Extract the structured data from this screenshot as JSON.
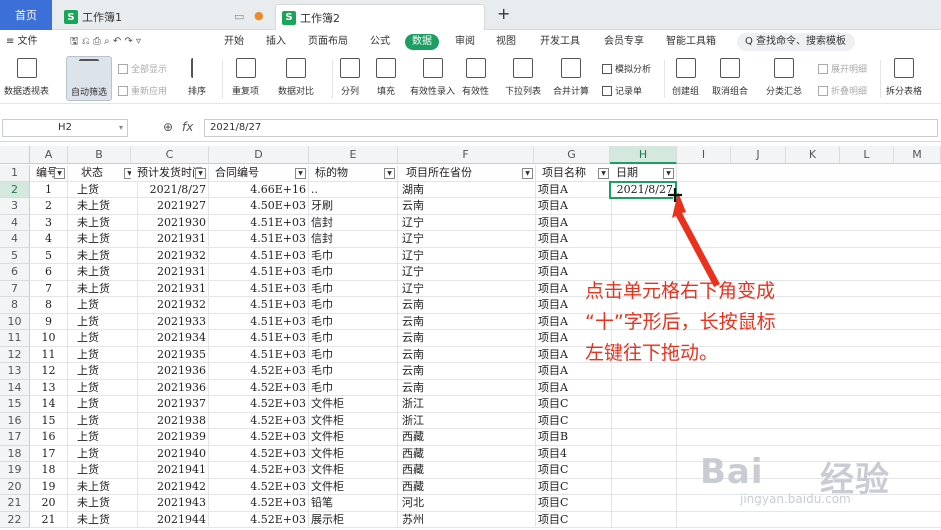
{
  "tabs": {
    "home": "首页",
    "doc1": "工作簿1",
    "doc2": "工作簿2",
    "new_tab": "+"
  },
  "menu": {
    "items": [
      "≡ 文件",
      "开始",
      "插入",
      "页面布局",
      "公式",
      "数据",
      "审阅",
      "视图",
      "开发工具",
      "会员专享",
      "智能工具箱"
    ],
    "active": "数据",
    "search": "Q 查找命令、搜索模板"
  },
  "ribbon": {
    "pivot": "数据透视表",
    "autofilter": "自动筛选",
    "show_all": "全部显示",
    "reapply": "重新应用",
    "sort": "排序",
    "dup": "重复项",
    "compare": "数据对比",
    "split": "分列",
    "fill": "填充",
    "validity": "有效性录入",
    "validity_dd": "有效性",
    "dropdown": "下拉列表",
    "merge_calc": "合并计算",
    "simulate": "模拟分析",
    "record": "记录单",
    "create_group": "创建组",
    "ungroup": "取消组合",
    "subtotal": "分类汇总",
    "expand": "展开明细",
    "collapse": "折叠明细",
    "split_table": "拆分表格"
  },
  "formula_bar": {
    "name_box": "H2",
    "fx": "fx",
    "value": "2021/8/27"
  },
  "columns": [
    "A",
    "B",
    "C",
    "D",
    "E",
    "F",
    "G",
    "H",
    "I",
    "J",
    "K",
    "L",
    "M"
  ],
  "header_row": {
    "a": "编号",
    "b": "状态",
    "c": "预计发货时间",
    "d": "合同编号",
    "e": "标的物",
    "f": "项目所在省份",
    "g": "项目名称",
    "h": "日期"
  },
  "rows": [
    {
      "n": "2",
      "a": "1",
      "b": "上货",
      "c": "2021/8/27",
      "d": "4.66E+16",
      "e": "..",
      "f": "湖南",
      "g": "项目A",
      "h": "2021/8/27"
    },
    {
      "n": "3",
      "a": "2",
      "b": "未上货",
      "c": "2021927",
      "d": "4.50E+03",
      "e": "牙刷",
      "f": "云南",
      "g": "项目A",
      "h": ""
    },
    {
      "n": "4",
      "a": "3",
      "b": "未上货",
      "c": "2021930",
      "d": "4.51E+03",
      "e": "信封",
      "f": "辽宁",
      "g": "项目A",
      "h": ""
    },
    {
      "n": "4",
      "a": "4",
      "b": "未上货",
      "c": "2021931",
      "d": "4.51E+03",
      "e": "信封",
      "f": "辽宁",
      "g": "项目A",
      "h": ""
    },
    {
      "n": "5",
      "a": "5",
      "b": "未上货",
      "c": "2021932",
      "d": "4.51E+03",
      "e": "毛巾",
      "f": "辽宁",
      "g": "项目A",
      "h": ""
    },
    {
      "n": "6",
      "a": "6",
      "b": "未上货",
      "c": "2021931",
      "d": "4.51E+03",
      "e": "毛巾",
      "f": "辽宁",
      "g": "项目A",
      "h": ""
    },
    {
      "n": "7",
      "a": "7",
      "b": "未上货",
      "c": "2021931",
      "d": "4.51E+03",
      "e": "毛巾",
      "f": "辽宁",
      "g": "项目A",
      "h": ""
    },
    {
      "n": "8",
      "a": "8",
      "b": "上货",
      "c": "2021932",
      "d": "4.51E+03",
      "e": "毛巾",
      "f": "云南",
      "g": "项目A",
      "h": ""
    },
    {
      "n": "10",
      "a": "9",
      "b": "上货",
      "c": "2021933",
      "d": "4.51E+03",
      "e": "毛巾",
      "f": "云南",
      "g": "项目A",
      "h": ""
    },
    {
      "n": "11",
      "a": "10",
      "b": "上货",
      "c": "2021934",
      "d": "4.51E+03",
      "e": "毛巾",
      "f": "云南",
      "g": "项目A",
      "h": ""
    },
    {
      "n": "12",
      "a": "11",
      "b": "上货",
      "c": "2021935",
      "d": "4.51E+03",
      "e": "毛巾",
      "f": "云南",
      "g": "项目A",
      "h": ""
    },
    {
      "n": "13",
      "a": "12",
      "b": "上货",
      "c": "2021936",
      "d": "4.52E+03",
      "e": "毛巾",
      "f": "云南",
      "g": "项目A",
      "h": ""
    },
    {
      "n": "14",
      "a": "13",
      "b": "上货",
      "c": "2021936",
      "d": "4.52E+03",
      "e": "毛巾",
      "f": "云南",
      "g": "项目A",
      "h": ""
    },
    {
      "n": "15",
      "a": "14",
      "b": "上货",
      "c": "2021937",
      "d": "4.52E+03",
      "e": "文件柜",
      "f": "浙江",
      "g": "项目C",
      "h": ""
    },
    {
      "n": "16",
      "a": "15",
      "b": "上货",
      "c": "2021938",
      "d": "4.52E+03",
      "e": "文件柜",
      "f": "浙江",
      "g": "项目C",
      "h": ""
    },
    {
      "n": "17",
      "a": "16",
      "b": "上货",
      "c": "2021939",
      "d": "4.52E+03",
      "e": "文件柜",
      "f": "西藏",
      "g": "项目B",
      "h": ""
    },
    {
      "n": "18",
      "a": "17",
      "b": "上货",
      "c": "2021940",
      "d": "4.52E+03",
      "e": "文件柜",
      "f": "西藏",
      "g": "项目4",
      "h": ""
    },
    {
      "n": "19",
      "a": "18",
      "b": "上货",
      "c": "2021941",
      "d": "4.52E+03",
      "e": "文件柜",
      "f": "西藏",
      "g": "项目C",
      "h": ""
    },
    {
      "n": "20",
      "a": "19",
      "b": "未上货",
      "c": "2021942",
      "d": "4.52E+03",
      "e": "文件柜",
      "f": "西藏",
      "g": "项目C",
      "h": ""
    },
    {
      "n": "21",
      "a": "20",
      "b": "未上货",
      "c": "2021943",
      "d": "4.52E+03",
      "e": "铅笔",
      "f": "河北",
      "g": "项目C",
      "h": ""
    },
    {
      "n": "22",
      "a": "21",
      "b": "未上货",
      "c": "2021944",
      "d": "4.52E+03",
      "e": "展示柜",
      "f": "苏州",
      "g": "项目C",
      "h": ""
    }
  ],
  "annotation": {
    "line1": "点击单元格右下角变成",
    "line2": "“十”字形后，长按鼠标",
    "line3": "左键往下拖动。"
  },
  "watermark": {
    "brand": "Bai",
    "brand2": "经验",
    "url": "jingyan.baidu.com"
  },
  "colors": {
    "accent": "#1e9e62",
    "annotation": "#e8321e",
    "home_tab": "#3c6fd8"
  }
}
